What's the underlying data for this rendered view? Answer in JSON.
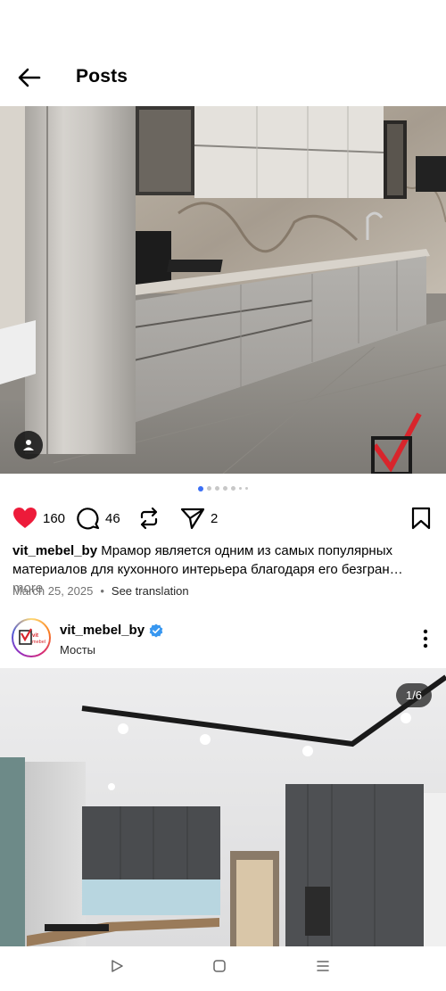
{
  "header": {
    "title": "Posts"
  },
  "post1": {
    "likes": "160",
    "comments": "46",
    "shares": "2",
    "caption_user": "vit_mebel_by",
    "caption_text": "Мрамор является одним из самых популярных материалов для кухонного интерьера благодаря его безгран…",
    "more_label": "more",
    "date": "March 25, 2025",
    "separator": "•",
    "see_translation": "See translation",
    "carousel_dots": 7,
    "active_dot": 0
  },
  "post2": {
    "username": "vit_mebel_by",
    "location": "Мосты",
    "counter": "1/6",
    "avatar_text": "vit mebel"
  },
  "colors": {
    "like": "#ed1b3a",
    "verified": "#3897f0",
    "dot_active": "#3b6ff5"
  },
  "icons": [
    "back-arrow-icon",
    "user-tag-icon",
    "heart-icon",
    "comment-icon",
    "repost-icon",
    "send-icon",
    "bookmark-icon",
    "verified-icon",
    "more-vertical-icon",
    "nav-back-icon",
    "nav-home-icon",
    "nav-menu-icon"
  ]
}
